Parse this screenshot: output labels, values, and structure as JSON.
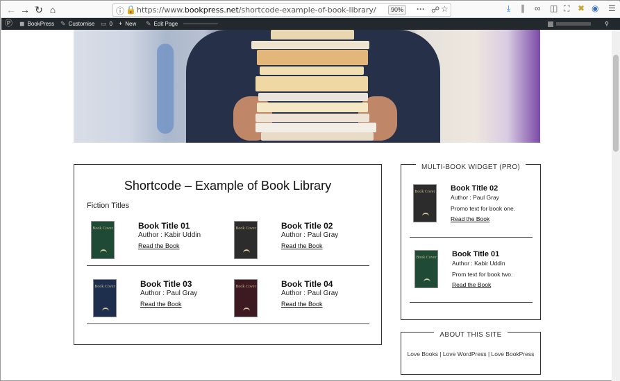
{
  "browser": {
    "url_scheme": "https://www.",
    "url_domain": "bookpress.net",
    "url_path": "/shortcode-example-of-book-library/",
    "zoom": "90%",
    "more_icon": "···"
  },
  "adminbar": {
    "site_name": "BookPress",
    "customise": "Customise",
    "comments_count": "0",
    "new": "New",
    "edit_page": "Edit Page"
  },
  "main": {
    "title": "Shortcode – Example of Book Library",
    "section": "Fiction Titles",
    "books": [
      {
        "title": "Book Title 01",
        "author": "Author : Kabir Uddin",
        "link": "Read the Book",
        "cover_color": "#1f4a35"
      },
      {
        "title": "Book Title 02",
        "author": "Author : Paul Gray",
        "link": "Read the Book",
        "cover_color": "#2c2c2c"
      },
      {
        "title": "Book Title 03",
        "author": "Author : Paul Gray",
        "link": "Read the Book",
        "cover_color": "#1e2f4d"
      },
      {
        "title": "Book Title 04",
        "author": "Author : Paul Gray",
        "link": "Read the Book",
        "cover_color": "#3d1a22"
      }
    ],
    "cover_label": "Book Cover"
  },
  "sidebar": {
    "multi_widget_title": "MULTI-BOOK WIDGET (PRO)",
    "widget_books": [
      {
        "title": "Book Title 02",
        "author": "Author : Paul Gray",
        "promo": "Promo text for book one.",
        "link": "Read the Book",
        "cover_color": "#2c2c2c"
      },
      {
        "title": "Book Title 01",
        "author": "Author : Kabir Uddin",
        "promo": "Prom text for book two.",
        "link": "Read the Book",
        "cover_color": "#1f4a35"
      }
    ],
    "about_title": "ABOUT THIS SITE",
    "about_text": "Love Books | Love WordPress | Love BookPress"
  }
}
